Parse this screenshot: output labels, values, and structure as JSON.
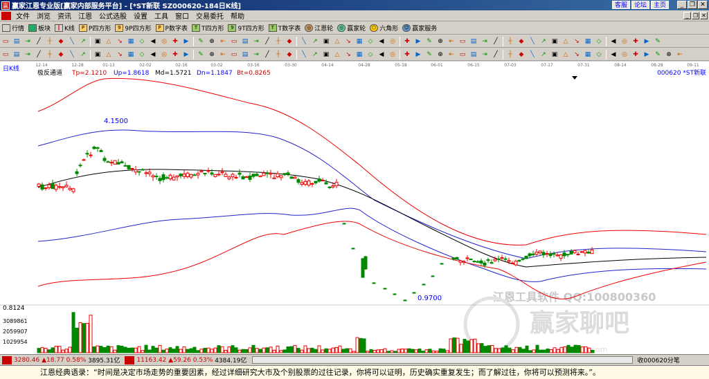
{
  "window": {
    "title": "赢家江恩专业版[赢家内部服务平台] - [*ST新联  SZ000620-184日K线]",
    "links": [
      "客服",
      "论坛",
      "主页"
    ]
  },
  "menu": [
    "文件",
    "浏览",
    "资讯",
    "江恩",
    "公式选股",
    "设置",
    "工具",
    "窗口",
    "交易委托",
    "帮助"
  ],
  "toolbar1": [
    "行情",
    "板块",
    "K线",
    "P四方形",
    "9P四方形",
    "P数字表",
    "T四方形",
    "9T四方形",
    "T数字表",
    "江恩轮",
    "赢家轮",
    "六角形",
    "赢家服务"
  ],
  "chart_header": {
    "period": "日K线",
    "indicator": "极反通道",
    "tp": "Tp=2.1210",
    "up": "Up=1.8618",
    "md": "Md=1.5721",
    "dn": "Dn=1.1847",
    "bt": "Bt=0.8265",
    "stock": "000620 *ST新联"
  },
  "dates": [
    "12-14",
    "12-28",
    "01-13",
    "02-02",
    "02-16",
    "03-02",
    "03-16",
    "03-30",
    "04-14",
    "04-28",
    "05-18",
    "06-01",
    "06-15",
    "07-03",
    "07-17",
    "07-31",
    "08-14",
    "08-28",
    "09-11"
  ],
  "annotations": {
    "high": "4.1500",
    "low": "0.9700",
    "wm1": "江恩工具软件  QQ:100800360",
    "wm2": "赢家聊吧",
    "wm3": "jiaoba.yjdn.com"
  },
  "volume": {
    "labels": [
      "0.8124",
      "3089861",
      "2059907",
      "1029954"
    ]
  },
  "status": {
    "sh_index": "3280.46",
    "sh_chg": "▲18.77",
    "sh_pct": "0.58%",
    "sh_amt": "3895.31亿",
    "sz_index": "11163.42",
    "sz_chg": "▲59.26",
    "sz_pct": "0.53%",
    "sz_amt": "4384.19亿",
    "right": "收000620分笔"
  },
  "quote": "江恩经典语录：“时间是决定市场走势的重要因素，经过详细研究大市及个别股票的过往记录，你将可以证明，历史确实重复发生；而了解过往，你将可以预测将来。”。"
}
